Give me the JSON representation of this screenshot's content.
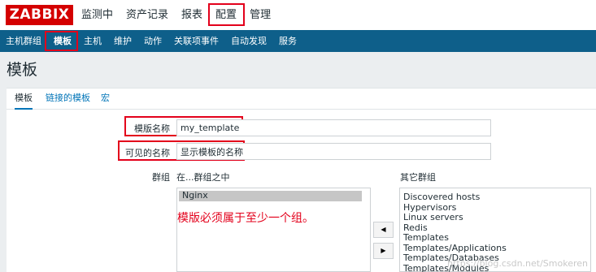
{
  "brand": {
    "logo_text": "ZABBIX",
    "color": "#d40000"
  },
  "top_nav": {
    "items": [
      {
        "label": "监测中"
      },
      {
        "label": "资产记录"
      },
      {
        "label": "报表"
      },
      {
        "label": "配置",
        "active": true
      },
      {
        "label": "管理"
      }
    ]
  },
  "sub_nav": {
    "items": [
      {
        "label": "主机群组"
      },
      {
        "label": "模板",
        "active": true
      },
      {
        "label": "主机"
      },
      {
        "label": "维护"
      },
      {
        "label": "动作"
      },
      {
        "label": "关联项事件"
      },
      {
        "label": "自动发现"
      },
      {
        "label": "服务"
      }
    ]
  },
  "page": {
    "title": "模板"
  },
  "tabs": [
    {
      "label": "模板",
      "active": true
    },
    {
      "label": "链接的模板"
    },
    {
      "label": "宏"
    }
  ],
  "form": {
    "template_name": {
      "label": "模版名称",
      "value": "my_template"
    },
    "visible_name": {
      "label": "可见的名称",
      "value": "显示模板的名称"
    },
    "groups": {
      "label": "群组",
      "in_groups_label": "在...群组之中",
      "other_groups_label": "其它群组",
      "in_groups": [
        "Nginx"
      ],
      "other_groups": [
        "Discovered hosts",
        "Hypervisors",
        "Linux servers",
        "Redis",
        "Templates",
        "Templates/Applications",
        "Templates/Databases",
        "Templates/Modules"
      ]
    }
  },
  "annotation": {
    "text": "模版必须属于至少一个组。",
    "color": "#e3001b"
  },
  "watermark": {
    "text": "https://blog.csdn.net/Smokeren"
  },
  "colors": {
    "subnav_bg": "#0e5f8a",
    "link": "#0275b8",
    "highlight_box": "#e3001b"
  }
}
